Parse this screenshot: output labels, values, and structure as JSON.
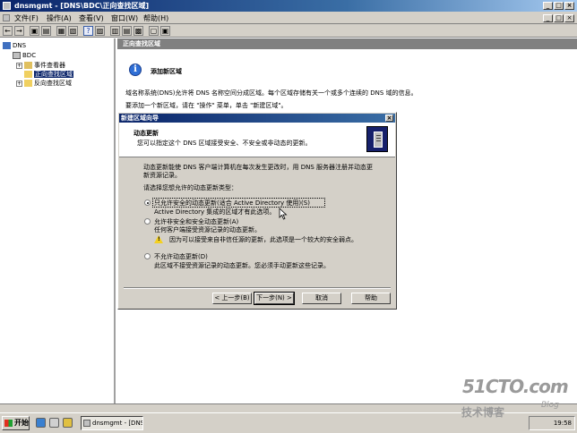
{
  "window": {
    "title": "dnsmgmt - [DNS\\BDC\\正向查找区域]",
    "controls": [
      "_",
      "□",
      "×"
    ]
  },
  "menubar": {
    "items": [
      "文件(F)",
      "操作(A)",
      "查看(V)",
      "窗口(W)",
      "帮助(H)"
    ],
    "mdi_controls": [
      "_",
      "□",
      "×"
    ]
  },
  "tree": {
    "root": "DNS",
    "server": "BDC",
    "children": [
      "事件查看器",
      "正向查找区域",
      "反向查找区域"
    ]
  },
  "right_pane": {
    "header": "正向查找区域",
    "section_title": "添加新区域",
    "para1": "域名称系统(DNS)允许将 DNS 名称空间分成区域。每个区域存储有关一个或多个连续的 DNS 域的信息。",
    "para2": "要添加一个新区域，请在 \"操作\" 菜单，单击 \"新建区域\"。"
  },
  "dialog": {
    "title": "新建区域向导",
    "close": "×",
    "header_title": "动态更新",
    "header_subtitle": "您可以指定这个 DNS 区域接受安全、不安全或非动态的更新。",
    "intro_line1": "动态更新能使 DNS 客户端计算机在每次发生更改时，用 DNS 服务器注册并动态更",
    "intro_line2": "新资源记录。",
    "prompt": "请选择您想允许的动态更新类型：",
    "options": [
      {
        "label": "只允许安全的动态更新(适合 Active Directory 使用)(S)",
        "desc": "Active Directory 集成的区域才有此选项。",
        "selected": true
      },
      {
        "label": "允许非安全和安全动态更新(A)",
        "desc": "任何客户端接受资源记录的动态更新。",
        "warning": "因为可以接受来自非信任源的更新，此选项是一个较大的安全弱点。",
        "selected": false
      },
      {
        "label": "不允许动态更新(D)",
        "desc": "此区域不接受资源记录的动态更新。您必须手动更新这些记录。",
        "selected": false
      }
    ],
    "buttons": {
      "back": "< 上一步(B)",
      "next": "下一步(N) >",
      "cancel": "取消",
      "help": "帮助"
    }
  },
  "taskbar": {
    "start": "开始",
    "task": "dnsmgmt - [DNS\\BDC\\...",
    "clock": "19:58"
  },
  "watermark": {
    "line1": "51CTO.com",
    "line2": "技术博客",
    "line3": "Blog"
  },
  "colors": {
    "title_active": "#0a246a",
    "face": "#d4d0c8",
    "info_icon": "#2f6fd6",
    "warning": "#f4d020"
  }
}
